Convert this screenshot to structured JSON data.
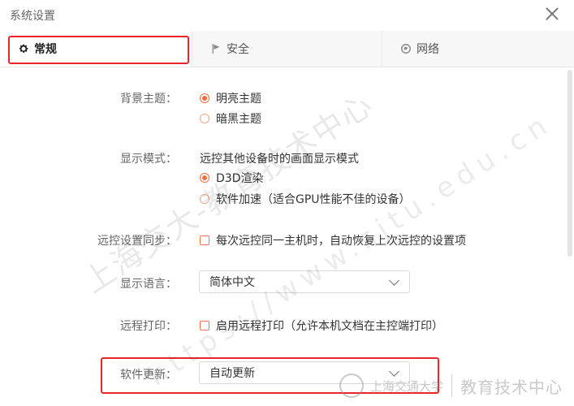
{
  "window": {
    "title": "系统设置"
  },
  "tabs": [
    {
      "label": "常规",
      "icon": "gear-icon",
      "active": true
    },
    {
      "label": "安全",
      "icon": "flag-icon",
      "active": false
    },
    {
      "label": "网络",
      "icon": "globe-icon",
      "active": false
    }
  ],
  "settings": {
    "theme": {
      "label": "背景主题：",
      "options": [
        {
          "label": "明亮主题",
          "selected": true
        },
        {
          "label": "暗黑主题",
          "selected": false
        }
      ]
    },
    "display_mode": {
      "label": "显示模式：",
      "description": "远控其他设备时的画面显示模式",
      "options": [
        {
          "label": "D3D渲染",
          "selected": true
        },
        {
          "label": "软件加速（适合GPU性能不佳的设备）",
          "selected": false
        }
      ]
    },
    "remote_sync": {
      "label": "远控设置同步：",
      "checkbox_label": "每次远控同一主机时，自动恢复上次远控的设置项",
      "checked": false
    },
    "language": {
      "label": "显示语言：",
      "value": "简体中文"
    },
    "remote_print": {
      "label": "远程打印：",
      "checkbox_label": "启用远程打印（允许本机文档在主控端打印）",
      "checked": false
    },
    "software_update": {
      "label": "软件更新：",
      "value": "自动更新"
    }
  },
  "watermark": {
    "line1": "上海交大-教育技术中心",
    "line2": "https://www.sjtu.edu.cn"
  },
  "logo": {
    "school": "上海交通大学",
    "center": "教育技术中心"
  },
  "colors": {
    "accent": "#f36d3f",
    "highlight": "#e8262c"
  }
}
